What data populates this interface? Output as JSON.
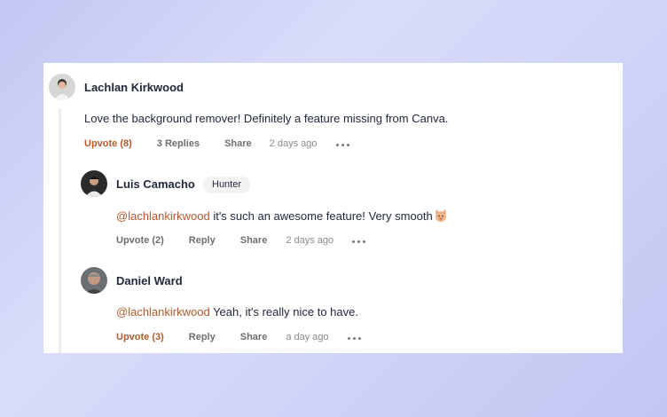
{
  "comments": [
    {
      "author": "Lachlan Kirkwood",
      "text": "Love the background remover! Definitely a feature missing from Canva.",
      "upvote_label": "Upvote (8)",
      "replies_label": "3 Replies",
      "share_label": "Share",
      "time": "2 days ago"
    },
    {
      "author": "Luis Camacho",
      "badge": "Hunter",
      "mention": "@lachlankirkwood",
      "text": " it's such an awesome feature! Very smooth",
      "emoji": "cat-face-emoji",
      "upvote_label": "Upvote (2)",
      "reply_label": "Reply",
      "share_label": "Share",
      "time": "2 days ago"
    },
    {
      "author": "Daniel Ward",
      "mention": "@lachlankirkwood",
      "text": " Yeah, it's really nice to have.",
      "upvote_label": "Upvote (3)",
      "reply_label": "Reply",
      "share_label": "Share",
      "time": "a day ago"
    }
  ],
  "colors": {
    "mention": "#b35a2b",
    "active_upvote": "#b35a2b",
    "text": "#21293c",
    "muted": "#6f6f6f"
  }
}
